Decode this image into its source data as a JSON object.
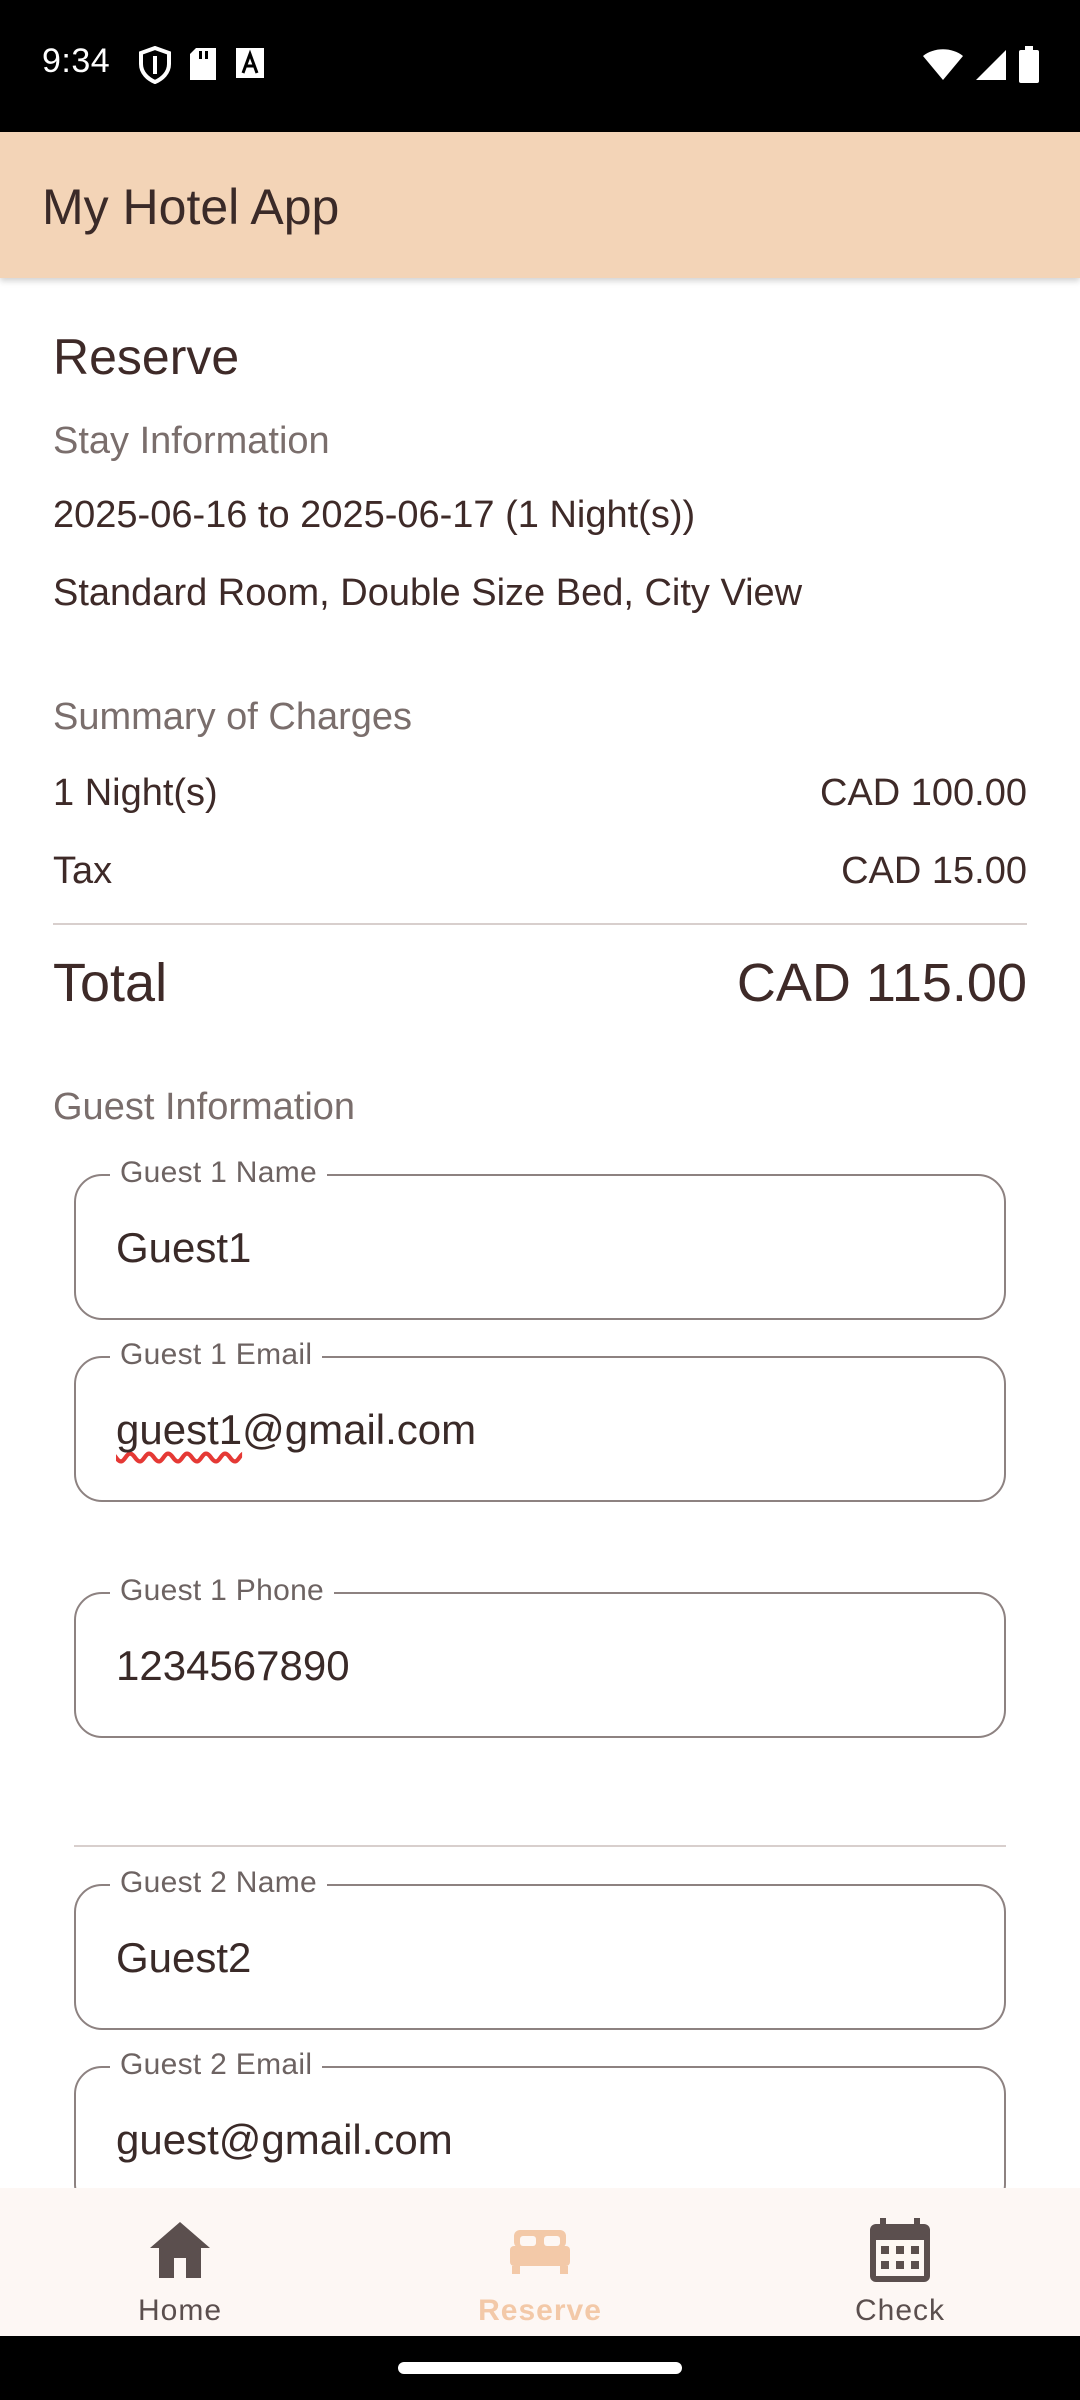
{
  "status_bar": {
    "time": "9:34",
    "left_icons": [
      "shield-icon",
      "sd-card-icon",
      "a-box-icon"
    ],
    "right_icons": [
      "wifi-icon",
      "signal-icon",
      "battery-icon"
    ]
  },
  "app_bar": {
    "title": "My Hotel App"
  },
  "reserve": {
    "title": "Reserve",
    "stay": {
      "heading": "Stay Information",
      "dates": "2025-06-16 to 2025-06-17 (1 Night(s))",
      "room": "Standard Room, Double Size Bed, City View"
    },
    "charges": {
      "heading": "Summary of Charges",
      "rows": [
        {
          "label": "1 Night(s)",
          "amount": "CAD 100.00"
        },
        {
          "label": "Tax",
          "amount": "CAD 15.00"
        }
      ],
      "total_label": "Total",
      "total_amount": "CAD 115.00"
    },
    "guest_info": {
      "heading": "Guest Information",
      "fields": [
        {
          "label": "Guest 1 Name",
          "value": "Guest1"
        },
        {
          "label": "Guest 1 Email",
          "value_underlined": "guest1",
          "value_rest": "@gmail.com"
        },
        {
          "label": "Guest 1 Phone",
          "value": "1234567890"
        },
        {
          "label": "Guest 2 Name",
          "value": "Guest2"
        },
        {
          "label": "Guest 2 Email",
          "value": "guest@gmail.com"
        }
      ]
    }
  },
  "bottom_nav": {
    "items": [
      {
        "label": "Home",
        "icon": "home-icon"
      },
      {
        "label": "Reserve",
        "icon": "bed-icon",
        "active": true
      },
      {
        "label": "Check",
        "icon": "calendar-icon"
      }
    ],
    "active_color": "#f3c9a8"
  },
  "colors": {
    "app_bar": "#f3d4b7",
    "text": "#3e2a28",
    "muted": "#7a6e6c"
  }
}
